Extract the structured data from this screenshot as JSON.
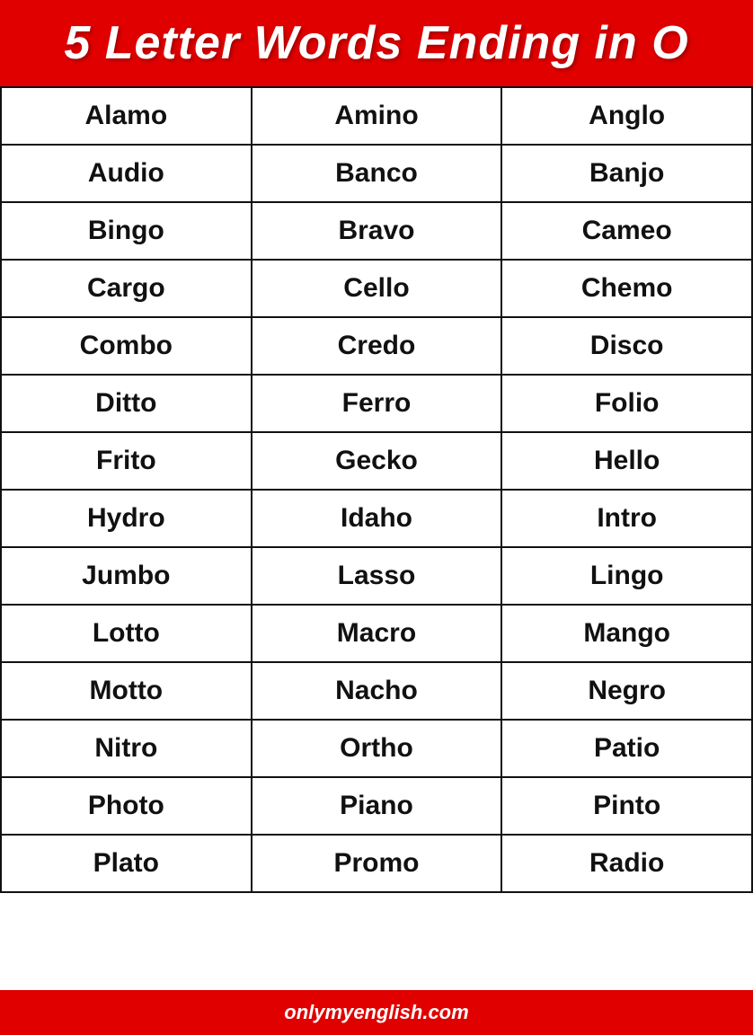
{
  "header": {
    "title": "5 Letter Words Ending in O"
  },
  "table": {
    "rows": [
      [
        "Alamo",
        "Amino",
        "Anglo"
      ],
      [
        "Audio",
        "Banco",
        "Banjo"
      ],
      [
        "Bingo",
        "Bravo",
        "Cameo"
      ],
      [
        "Cargo",
        "Cello",
        "Chemo"
      ],
      [
        "Combo",
        "Credo",
        "Disco"
      ],
      [
        "Ditto",
        "Ferro",
        "Folio"
      ],
      [
        "Frito",
        "Gecko",
        "Hello"
      ],
      [
        "Hydro",
        "Idaho",
        "Intro"
      ],
      [
        "Jumbo",
        "Lasso",
        "Lingo"
      ],
      [
        "Lotto",
        "Macro",
        "Mango"
      ],
      [
        "Motto",
        "Nacho",
        "Negro"
      ],
      [
        "Nitro",
        "Ortho",
        "Patio"
      ],
      [
        "Photo",
        "Piano",
        "Pinto"
      ],
      [
        "Plato",
        "Promo",
        "Radio"
      ]
    ]
  },
  "footer": {
    "text": "onlymyenglish.com"
  }
}
